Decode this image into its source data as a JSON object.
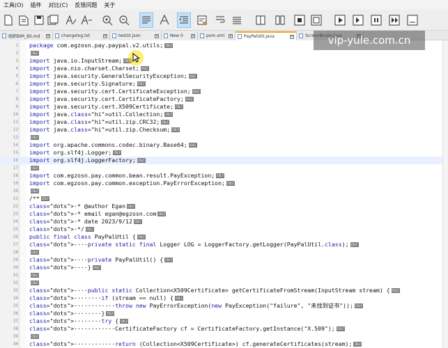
{
  "menu": [
    "工具(O)",
    "插件",
    "对比(C)",
    "反馈问题",
    "关于"
  ],
  "tabs": [
    {
      "label": "组织BIM_BS.md"
    },
    {
      "label": "changelog.txt"
    },
    {
      "label": "testUI.json"
    },
    {
      "label": "New 0"
    },
    {
      "label": "pom.xml"
    },
    {
      "label": "PayPalUtil.java"
    },
    {
      "label": "ScreenBrush.java"
    }
  ],
  "active_tab": 5,
  "watermark": "vip-yule.com.cn",
  "toolbar_icons": [
    "new-file-icon",
    "open-file-icon",
    "save-icon",
    "save-all-icon",
    "font-a-icon",
    "font-a-alt-icon",
    "zoom-in-icon",
    "zoom-out-icon",
    "align-icon",
    "font-style-icon",
    "indent-icon",
    "note-icon",
    "wrap-icon",
    "column-icon",
    "split-icon",
    "compare-icon",
    "record-icon",
    "play-icon",
    "stop-icon",
    "play-all-icon",
    "macro-icon"
  ],
  "colors": {
    "keyword": "#2222aa",
    "highlight": "#8fe3ff",
    "active_tab_accent": "#f0a030"
  },
  "lines": [
    {
      "num": "1",
      "text": "package com.egzosn.pay.paypal.v2.utils;"
    },
    {
      "num": "2",
      "text": ""
    },
    {
      "num": "3",
      "text": "import java.io.InputStream;"
    },
    {
      "num": "4",
      "text": "import java.nio.charset.Charset;"
    },
    {
      "num": "5",
      "text": "import java.security.GeneralSecurityException;"
    },
    {
      "num": "6",
      "text": "import java.security.Signature;"
    },
    {
      "num": "7",
      "text": "import java.security.cert.CertificateException;"
    },
    {
      "num": "8",
      "text": "import java.security.cert.CertificateFactory;"
    },
    {
      "num": "9",
      "text": "import java.security.cert.X509Certificate;"
    },
    {
      "num": "10",
      "text": "import java.util.Collection;"
    },
    {
      "num": "11",
      "text": "import java.util.zip.CRC32;"
    },
    {
      "num": "12",
      "text": "import java.util.zip.Checksum;"
    },
    {
      "num": "13",
      "text": ""
    },
    {
      "num": "14",
      "text": "import org.apache.commons.codec.binary.Base64;"
    },
    {
      "num": "15",
      "text": "import org.slf4j.Logger;"
    },
    {
      "num": "16",
      "text": "import org.slf4j.LoggerFactory;"
    },
    {
      "num": "17",
      "text": ""
    },
    {
      "num": "18",
      "text": "import com.egzosn.pay.common.bean.result.PayException;"
    },
    {
      "num": "19",
      "text": "import com.egzosn.pay.common.exception.PayErrorException;"
    },
    {
      "num": "20",
      "text": ""
    },
    {
      "num": "21",
      "text": "/**"
    },
    {
      "num": "22",
      "text": " * @author Egan"
    },
    {
      "num": "23",
      "text": " * email egan@egzosn.com"
    },
    {
      "num": "24",
      "text": " * date 2023/9/12"
    },
    {
      "num": "25",
      "text": " */"
    },
    {
      "num": "26",
      "text": "public final class PayPalUtil {"
    },
    {
      "num": "27",
      "text": "    private static final Logger LOG = LoggerFactory.getLogger(PayPalUtil.class);"
    },
    {
      "num": "28",
      "text": ""
    },
    {
      "num": "29",
      "text": "    private PayPalUtil() {"
    },
    {
      "num": "30",
      "text": "    }"
    },
    {
      "num": "31",
      "text": ""
    },
    {
      "num": "32",
      "text": ""
    },
    {
      "num": "33",
      "text": "    public static Collection<X509Certificate> getCertificateFromStream(InputStream stream) {"
    },
    {
      "num": "34",
      "text": "        if (stream == null) {"
    },
    {
      "num": "35",
      "text": "            throw new PayErrorException(new PayException(\"failure\", \"未找到证书\"));"
    },
    {
      "num": "36",
      "text": "        }"
    },
    {
      "num": "37",
      "text": "        try {"
    },
    {
      "num": "38",
      "text": "            CertificateFactory cf = CertificateFactory.getInstance(\"X.509\");"
    },
    {
      "num": "39",
      "text": ""
    },
    {
      "num": "40",
      "text": "            return (Collection<X509Certificate>) cf.generateCertificates(stream);"
    }
  ]
}
